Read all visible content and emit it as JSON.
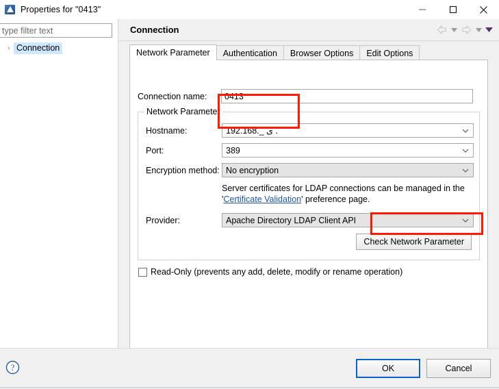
{
  "window": {
    "title": "Properties for \"0413\"",
    "app_icon": "directory-studio-icon",
    "controls": {
      "minimize": "minimize-icon",
      "maximize": "maximize-icon",
      "close": "close-icon"
    }
  },
  "sidebar": {
    "filter": {
      "value": "",
      "placeholder": "type filter text"
    },
    "tree": [
      {
        "label": "Connection",
        "expander": "›",
        "selected": true
      }
    ]
  },
  "page": {
    "title": "Connection",
    "nav": {
      "back": "back-arrow-icon",
      "back_menu": "chevron-down-icon",
      "forward": "forward-arrow-icon",
      "forward_menu": "chevron-down-icon",
      "view_menu": "view-menu-chevron-icon"
    }
  },
  "tabs": [
    {
      "label": "Network Parameter",
      "active": true
    },
    {
      "label": "Authentication",
      "active": false
    },
    {
      "label": "Browser Options",
      "active": false
    },
    {
      "label": "Edit Options",
      "active": false
    }
  ],
  "form": {
    "connection_name": {
      "label": "Connection name:",
      "value": "0413",
      "placeholder": ""
    },
    "group_title": "Network Parameter",
    "hostname": {
      "label": "Hostname:",
      "value": "192.168._ ى  .",
      "placeholder": ""
    },
    "port": {
      "label": "Port:",
      "value": "389",
      "placeholder": ""
    },
    "encryption": {
      "label": "Encryption method:",
      "value": "No encryption"
    },
    "cert_note": {
      "prefix": "Server certificates for LDAP connections can be managed in the '",
      "link": "Certificate Validation",
      "suffix": "' preference page."
    },
    "provider": {
      "label": "Provider:",
      "value": "Apache Directory LDAP Client API"
    },
    "check_button": "Check Network Parameter",
    "read_only": {
      "label": "Read-Only (prevents any add, delete, modify or rename operation)",
      "checked": false
    }
  },
  "footer": {
    "help": "help-icon",
    "ok": "OK",
    "cancel": "Cancel"
  },
  "colors": {
    "annotation": "#ff1a00",
    "default_button_border": "#0a64c8",
    "selection": "#cde8ff",
    "link": "#1b56b0"
  }
}
